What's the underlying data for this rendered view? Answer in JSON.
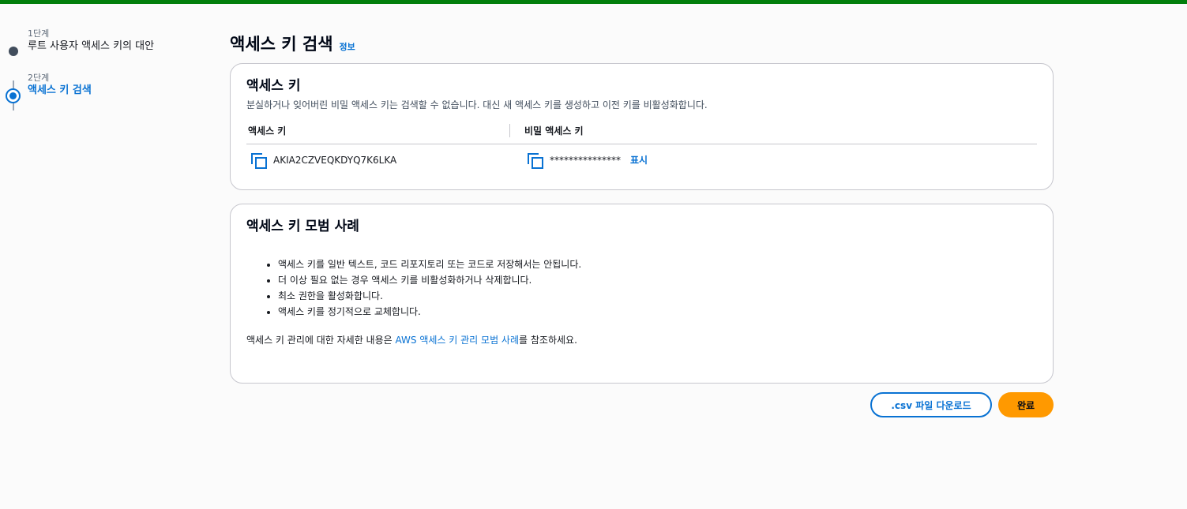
{
  "steps": [
    {
      "number": "1단계",
      "title": "루트 사용자 액세스 키의 대안"
    },
    {
      "number": "2단계",
      "title": "액세스 키 검색"
    }
  ],
  "header": {
    "title": "액세스 키 검색",
    "info_link": "정보"
  },
  "access_key_panel": {
    "title": "액세스 키",
    "description": "분실하거나 잊어버린 비밀 액세스 키는 검색할 수 없습니다. 대신 새 액세스 키를 생성하고 이전 키를 비활성화합니다.",
    "col_access_key": "액세스 키",
    "col_secret_key": "비밀 액세스 키",
    "access_key_value": "AKIA2CZVEQKDYQ7K6LKA",
    "secret_key_masked": "***************",
    "show_label": "표시"
  },
  "practices_panel": {
    "title": "액세스 키 모범 사례",
    "items": [
      "액세스 키를 일반 텍스트, 코드 리포지토리 또는 코드로 저장해서는 안됩니다.",
      "더 이상 필요 없는 경우 액세스 키를 비활성화하거나 삭제합니다.",
      "최소 권한을 활성화합니다.",
      "액세스 키를 정기적으로 교체합니다."
    ],
    "footer_prefix": "액세스 키 관리에 대한 자세한 내용은 ",
    "footer_link": "AWS 액세스 키 관리 모범 사례",
    "footer_suffix": "를 참조하세요."
  },
  "actions": {
    "download_label": ".csv 파일 다운로드",
    "done_label": "완료"
  },
  "colors": {
    "accent": "#0972d3",
    "primary_button": "#ff9900",
    "top_bar": "#037f0c"
  }
}
